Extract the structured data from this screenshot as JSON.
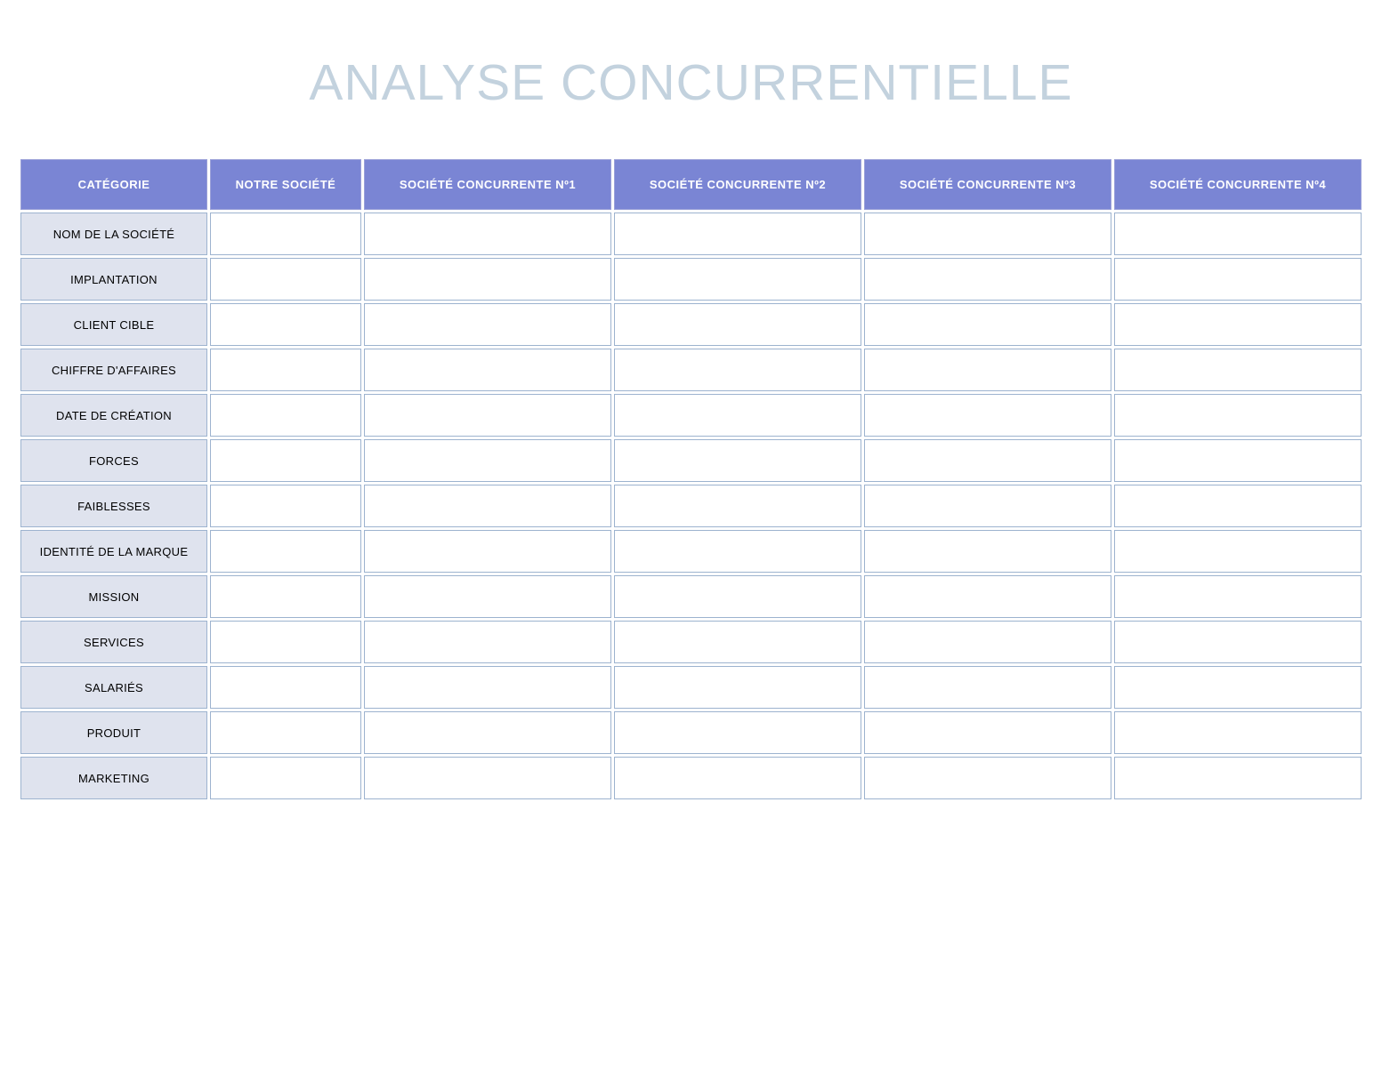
{
  "title": "ANALYSE CONCURRENTIELLE",
  "columns": {
    "category": "CATÉGORIE",
    "ours": "NOTRE SOCIÉTÉ",
    "comp1": "SOCIÉTÉ CONCURRENTE Nº1",
    "comp2": "SOCIÉTÉ CONCURRENTE Nº2",
    "comp3": "SOCIÉTÉ CONCURRENTE Nº3",
    "comp4": "SOCIÉTÉ CONCURRENTE Nº4"
  },
  "rows": [
    {
      "label": "NOM DE LA SOCIÉTÉ",
      "ours": "",
      "comp1": "",
      "comp2": "",
      "comp3": "",
      "comp4": ""
    },
    {
      "label": "IMPLANTATION",
      "ours": "",
      "comp1": "",
      "comp2": "",
      "comp3": "",
      "comp4": ""
    },
    {
      "label": "CLIENT CIBLE",
      "ours": "",
      "comp1": "",
      "comp2": "",
      "comp3": "",
      "comp4": ""
    },
    {
      "label": "CHIFFRE D'AFFAIRES",
      "ours": "",
      "comp1": "",
      "comp2": "",
      "comp3": "",
      "comp4": ""
    },
    {
      "label": "DATE DE CRÉATION",
      "ours": "",
      "comp1": "",
      "comp2": "",
      "comp3": "",
      "comp4": ""
    },
    {
      "label": "FORCES",
      "ours": "",
      "comp1": "",
      "comp2": "",
      "comp3": "",
      "comp4": ""
    },
    {
      "label": "FAIBLESSES",
      "ours": "",
      "comp1": "",
      "comp2": "",
      "comp3": "",
      "comp4": ""
    },
    {
      "label": "IDENTITÉ DE LA MARQUE",
      "ours": "",
      "comp1": "",
      "comp2": "",
      "comp3": "",
      "comp4": ""
    },
    {
      "label": "MISSION",
      "ours": "",
      "comp1": "",
      "comp2": "",
      "comp3": "",
      "comp4": ""
    },
    {
      "label": "SERVICES",
      "ours": "",
      "comp1": "",
      "comp2": "",
      "comp3": "",
      "comp4": ""
    },
    {
      "label": "SALARIÉS",
      "ours": "",
      "comp1": "",
      "comp2": "",
      "comp3": "",
      "comp4": ""
    },
    {
      "label": "PRODUIT",
      "ours": "",
      "comp1": "",
      "comp2": "",
      "comp3": "",
      "comp4": ""
    },
    {
      "label": "MARKETING",
      "ours": "",
      "comp1": "",
      "comp2": "",
      "comp3": "",
      "comp4": ""
    }
  ]
}
